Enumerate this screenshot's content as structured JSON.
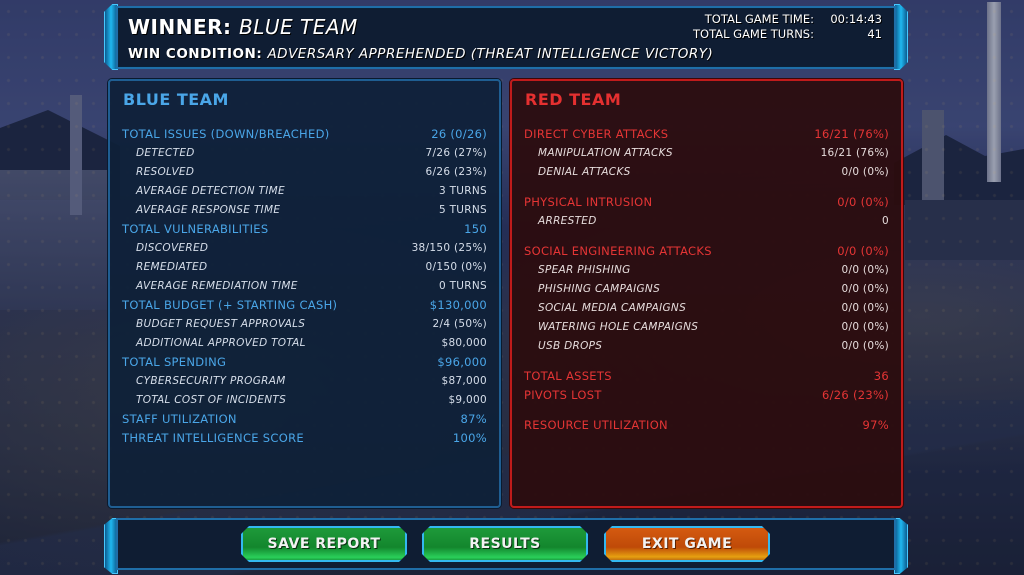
{
  "header": {
    "winner_label": "WINNER:",
    "winner_value": "BLUE TEAM",
    "condition_label": "WIN CONDITION:",
    "condition_value": "ADVERSARY APPREHENDED (THREAT INTELLIGENCE VICTORY)",
    "game_time_label": "TOTAL GAME TIME:",
    "game_time_value": "00:14:43",
    "game_turns_label": "TOTAL GAME TURNS:",
    "game_turns_value": "41"
  },
  "blue_team": {
    "title": "BLUE TEAM",
    "color": "#4aa6e8",
    "rows": [
      {
        "label": "TOTAL ISSUES (DOWN/BREACHED)",
        "value": "26 (0/26)",
        "type": "main"
      },
      {
        "label": "DETECTED",
        "value": "7/26 (27%)",
        "type": "sub"
      },
      {
        "label": "RESOLVED",
        "value": "6/26 (23%)",
        "type": "sub"
      },
      {
        "label": "AVERAGE DETECTION TIME",
        "value": "3 TURNS",
        "type": "sub"
      },
      {
        "label": "AVERAGE RESPONSE TIME",
        "value": "5 TURNS",
        "type": "sub"
      },
      {
        "label": "TOTAL VULNERABILITIES",
        "value": "150",
        "type": "main"
      },
      {
        "label": "DISCOVERED",
        "value": "38/150 (25%)",
        "type": "sub"
      },
      {
        "label": "REMEDIATED",
        "value": "0/150 (0%)",
        "type": "sub"
      },
      {
        "label": "AVERAGE REMEDIATION TIME",
        "value": "0 TURNS",
        "type": "sub"
      },
      {
        "label": "TOTAL BUDGET (+ STARTING CASH)",
        "value": "$130,000",
        "type": "main"
      },
      {
        "label": "BUDGET REQUEST APPROVALS",
        "value": "2/4 (50%)",
        "type": "sub"
      },
      {
        "label": "ADDITIONAL APPROVED TOTAL",
        "value": "$80,000",
        "type": "sub"
      },
      {
        "label": "TOTAL SPENDING",
        "value": "$96,000",
        "type": "main"
      },
      {
        "label": "CYBERSECURITY PROGRAM",
        "value": "$87,000",
        "type": "sub"
      },
      {
        "label": "TOTAL COST OF INCIDENTS",
        "value": "$9,000",
        "type": "sub"
      },
      {
        "label": "STAFF UTILIZATION",
        "value": "87%",
        "type": "main"
      },
      {
        "label": "THREAT INTELLIGENCE SCORE",
        "value": "100%",
        "type": "main"
      }
    ]
  },
  "red_team": {
    "title": "RED TEAM",
    "color": "#e53030",
    "rows": [
      {
        "label": "DIRECT CYBER ATTACKS",
        "value": "16/21 (76%)",
        "type": "main"
      },
      {
        "label": "MANIPULATION ATTACKS",
        "value": "16/21 (76%)",
        "type": "sub"
      },
      {
        "label": "DENIAL ATTACKS",
        "value": "0/0 (0%)",
        "type": "sub"
      },
      {
        "label": "PHYSICAL INTRUSION",
        "value": "0/0 (0%)",
        "type": "main"
      },
      {
        "label": "ARRESTED",
        "value": "0",
        "type": "sub"
      },
      {
        "label": "SOCIAL ENGINEERING ATTACKS",
        "value": "0/0 (0%)",
        "type": "main"
      },
      {
        "label": "SPEAR PHISHING",
        "value": "0/0 (0%)",
        "type": "sub"
      },
      {
        "label": "PHISHING CAMPAIGNS",
        "value": "0/0 (0%)",
        "type": "sub"
      },
      {
        "label": "SOCIAL MEDIA CAMPAIGNS",
        "value": "0/0 (0%)",
        "type": "sub"
      },
      {
        "label": "WATERING HOLE CAMPAIGNS",
        "value": "0/0 (0%)",
        "type": "sub"
      },
      {
        "label": "USB DROPS",
        "value": "0/0 (0%)",
        "type": "sub"
      },
      {
        "label": "TOTAL ASSETS",
        "value": "36",
        "type": "main"
      },
      {
        "label": "PIVOTS LOST",
        "value": "6/26 (23%)",
        "type": "main"
      },
      {
        "label": "RESOURCE UTILIZATION",
        "value": "97%",
        "type": "main"
      }
    ]
  },
  "footer": {
    "buttons": [
      {
        "label": "SAVE REPORT",
        "color": "#17902f"
      },
      {
        "label": "RESULTS",
        "color": "#17902f"
      },
      {
        "label": "EXIT GAME",
        "color": "#c94f0a"
      }
    ]
  }
}
